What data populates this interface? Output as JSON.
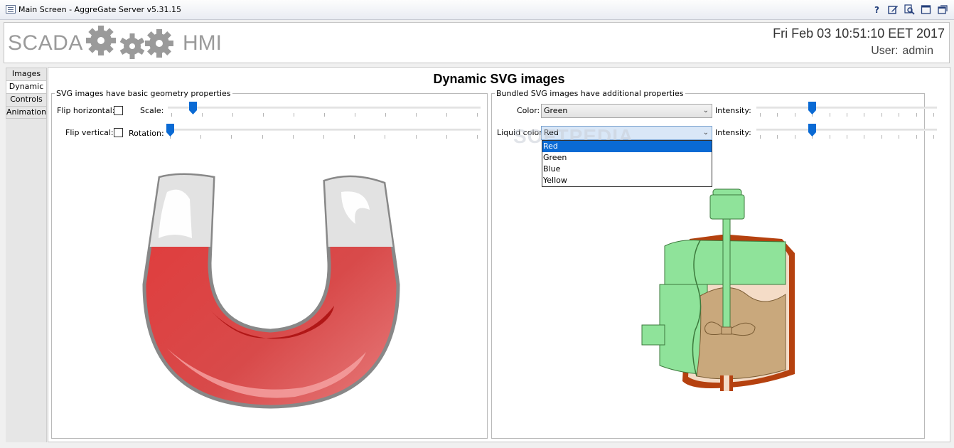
{
  "window": {
    "title": "Main Screen - AggreGate Server v5.31.15",
    "buttons": [
      "?",
      "edit-icon",
      "search-icon",
      "maximize-icon",
      "restore-icon"
    ]
  },
  "header": {
    "logo_left": "SCADA",
    "logo_right": "HMI",
    "datetime": "Fri Feb 03 10:51:10 EET 2017",
    "user_label": "User:",
    "user_name": "admin"
  },
  "tabs": [
    {
      "label": "Images"
    },
    {
      "label": "Dynamic"
    },
    {
      "label": "Controls"
    },
    {
      "label": "Animation"
    }
  ],
  "active_tab": "Dynamic",
  "page": {
    "title": "Dynamic SVG images"
  },
  "geometry_panel": {
    "legend": "SVG images have basic geometry properties",
    "flip_horizontal_label": "Flip horizontal:",
    "flip_horizontal_checked": false,
    "scale_label": "Scale:",
    "scale_value": 0.07,
    "flip_vertical_label": "Flip vertical:",
    "flip_vertical_checked": false,
    "rotation_label": "Rotation:",
    "rotation_value": 0.0
  },
  "bundled_panel": {
    "legend": "Bundled SVG images have additional properties",
    "color_label": "Color:",
    "color_value": "Green",
    "intensity_label_1": "Intensity:",
    "intensity_value_1": 0.3,
    "liquid_color_label": "Liquid color:",
    "liquid_color_value": "Red",
    "intensity_label_2": "Intensity:",
    "intensity_value_2": 0.3,
    "liquid_options": [
      "Red",
      "Green",
      "Blue",
      "Yellow"
    ],
    "liquid_selected": "Red"
  },
  "watermark": "SOFTPEDIA",
  "colors": {
    "accent": "#0a6ad4",
    "magnet_red": "#d93a3a",
    "tank_green": "#8fe39a",
    "tank_rust": "#b5410f",
    "liquid_brown": "#c9a87c"
  }
}
